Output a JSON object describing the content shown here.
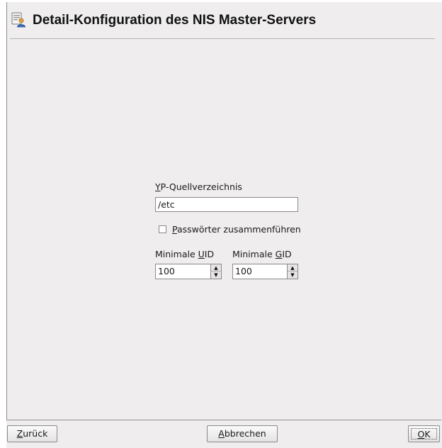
{
  "header": {
    "title": "Detail-Konfiguration des NIS Master-Servers",
    "icon": "nis-server-config-icon"
  },
  "form": {
    "source_dir": {
      "label_mnemonic": "Y",
      "label_rest": "P-Quellverzeichnis",
      "value": "/etc"
    },
    "merge_passwords": {
      "label_mnemonic": "P",
      "label_rest": "asswörter zusammenführen",
      "checked": false
    },
    "min_uid": {
      "label_prefix": "Minimale ",
      "label_mnemonic": "U",
      "label_rest": "ID",
      "value": "100"
    },
    "min_gid": {
      "label_prefix": "Minimale ",
      "label_mnemonic": "G",
      "label_rest": "ID",
      "value": "100"
    }
  },
  "buttons": {
    "back": {
      "mnemonic": "Z",
      "rest": "urück"
    },
    "cancel": {
      "mnemonic": "A",
      "rest": "bbrechen"
    },
    "ok": {
      "mnemonic": "O",
      "rest": "K"
    }
  },
  "colors": {
    "window_bg": "#efedee",
    "border": "#8a8a8a"
  }
}
